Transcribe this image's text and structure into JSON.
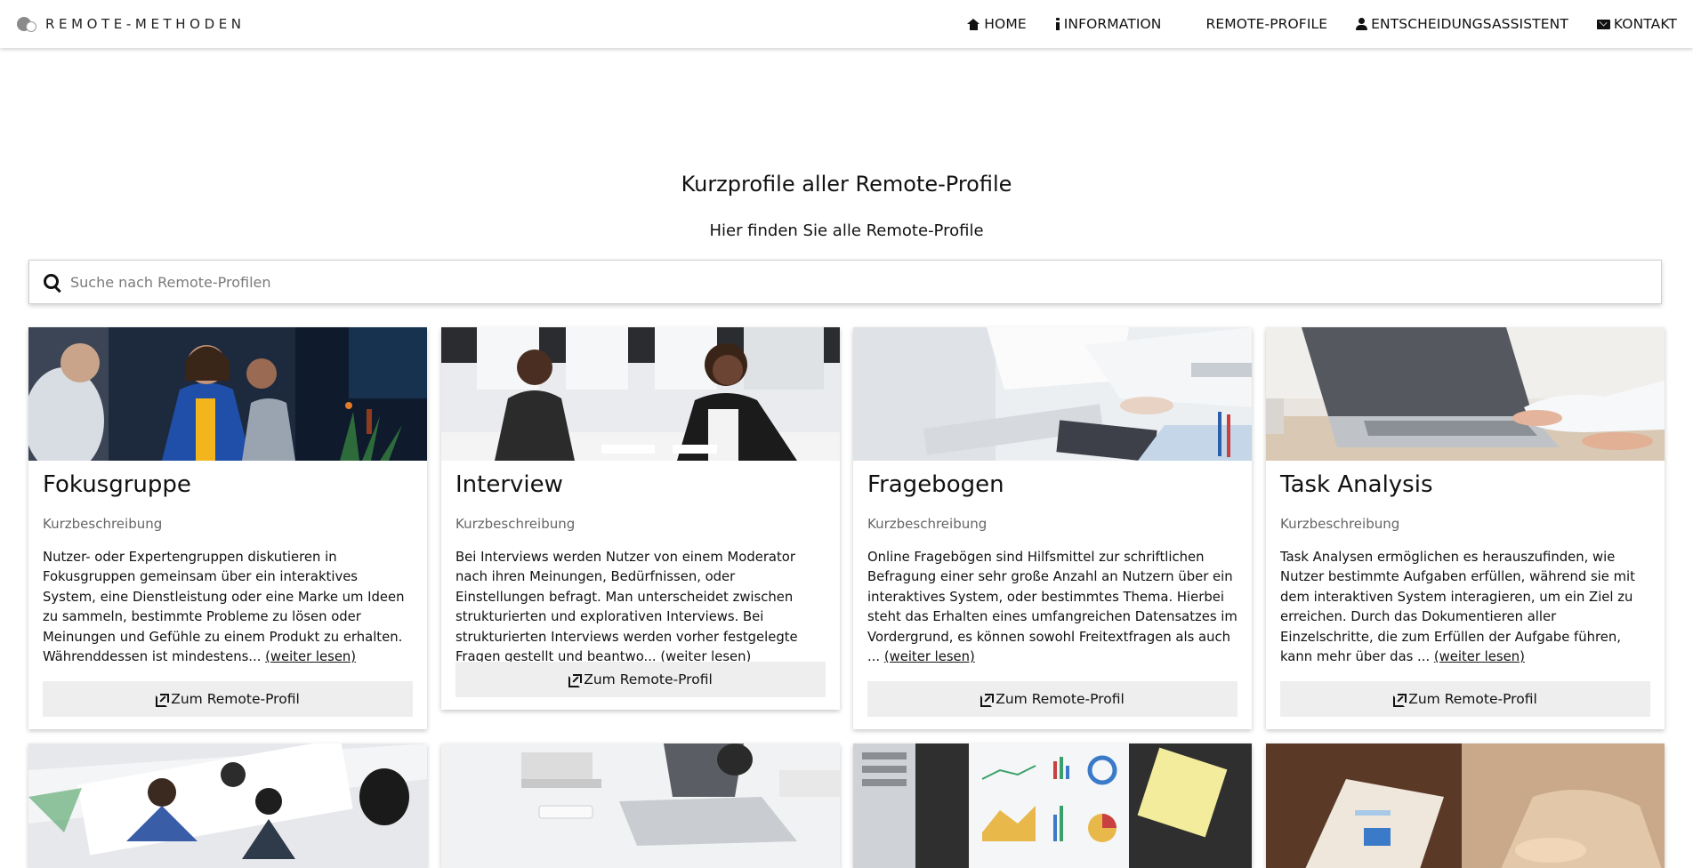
{
  "brand": {
    "name": "REMOTE-METHODEN"
  },
  "nav": {
    "items": [
      {
        "label": "HOME",
        "icon": "home-icon"
      },
      {
        "label": "INFORMATION",
        "icon": "info-icon"
      },
      {
        "label": "REMOTE-PROFILE",
        "icon": "grid-icon"
      },
      {
        "label": "ENTSCHEIDUNGSASSISTENT",
        "icon": "user-icon"
      },
      {
        "label": "KONTAKT",
        "icon": "envelope-icon"
      }
    ]
  },
  "main": {
    "title": "Kurzprofile aller Remote-Profile",
    "subtitle": "Hier finden Sie alle Remote-Profile"
  },
  "search": {
    "placeholder": "Suche nach Remote-Profilen",
    "value": ""
  },
  "cards": [
    {
      "title": "Fokusgruppe",
      "subtitle": "Kurzbeschreibung",
      "text": "Nutzer- oder Expertengruppen diskutieren in Fokusgruppen gemeinsam über ein interaktives System, eine Dienstleistung oder eine Marke um Ideen zu sammeln, bestimmte Probleme zu lösen oder Meinungen und Gefühle zu einem Produkt zu erhalten. Währenddessen ist mindestens...",
      "more": "(weiter lesen)",
      "button": "Zum Remote-Profil"
    },
    {
      "title": "Interview",
      "subtitle": "Kurzbeschreibung",
      "text": "Bei Interviews werden Nutzer von einem Moderator nach ihren Meinungen, Bedürfnissen, oder Einstellungen befragt. Man unterscheidet zwischen strukturierten und explorativen Interviews. Bei strukturierten Interviews werden vorher festgelegte Fragen gestellt und beantwo...",
      "more": "(weiter lesen)",
      "button": "Zum Remote-Profil"
    },
    {
      "title": "Fragebogen",
      "subtitle": "Kurzbeschreibung",
      "text": "Online Fragebögen sind Hilfsmittel zur schriftlichen Befragung einer sehr große Anzahl an Nutzern über ein interaktives System, oder bestimmtes Thema. Hierbei steht das Erhalten eines umfangreichen Datensatzes im Vordergrund, es können sowohl Freitextfragen als auch ...",
      "more": "(weiter lesen)",
      "button": "Zum Remote-Profil"
    },
    {
      "title": "Task Analysis",
      "subtitle": "Kurzbeschreibung",
      "text": "Task Analysen ermöglichen es herauszufinden, wie Nutzer bestimmte Aufgaben erfüllen, während sie mit dem interaktiven System interagieren, um ein Ziel zu erreichen. Durch das Dokumentieren aller Einzelschritte, die zum Erfüllen der Aufgabe führen, kann mehr über das ...",
      "more": "(weiter lesen)",
      "button": "Zum Remote-Profil"
    }
  ]
}
